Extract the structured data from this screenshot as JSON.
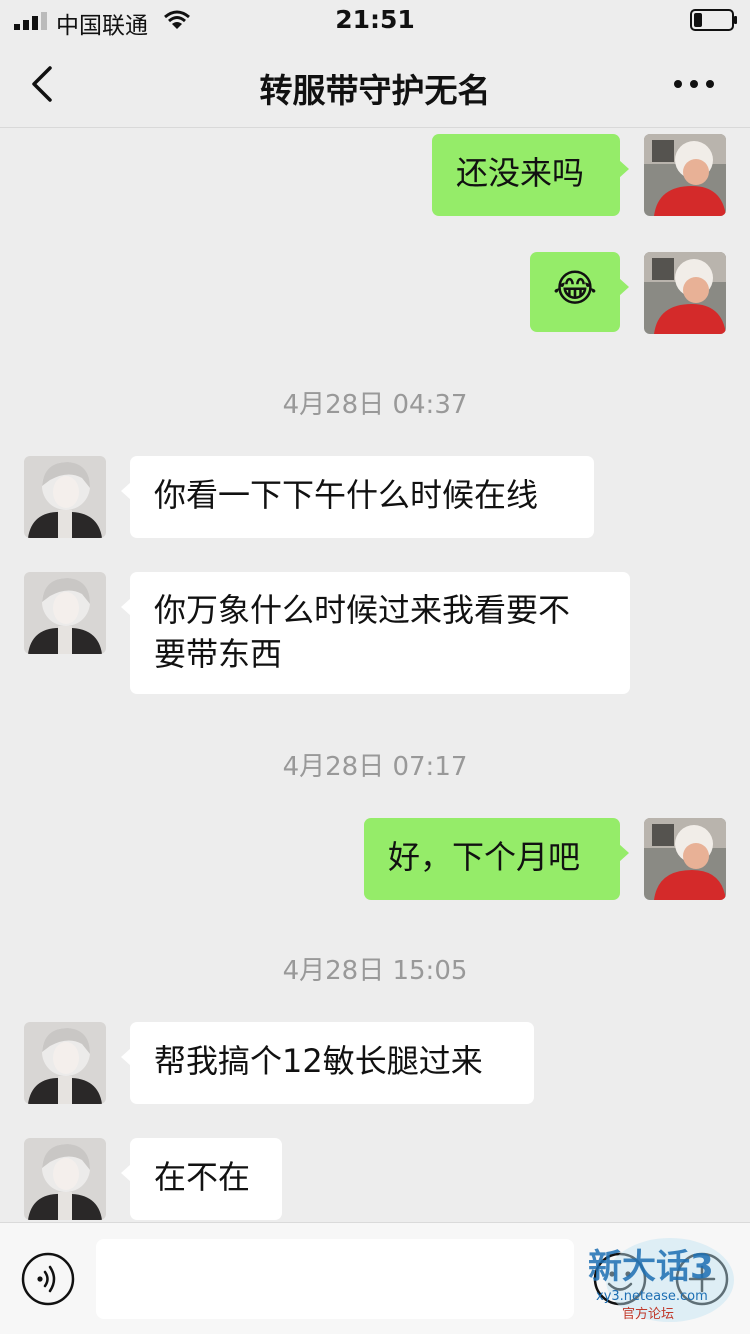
{
  "status_bar": {
    "carrier": "中国联通",
    "time": "21:51"
  },
  "nav": {
    "title": "转服带守护无名"
  },
  "messages": {
    "m1": {
      "text": "还没来吗"
    },
    "m2": {
      "emoji": "😂"
    },
    "ts1": {
      "text": "4月28日 04:37"
    },
    "m3": {
      "text": "你看一下下午什么时候在线"
    },
    "m4": {
      "line1": "你万象什么时候过来我看要不",
      "line2": "要带东西"
    },
    "ts2": {
      "text": "4月28日 07:17"
    },
    "m5": {
      "text": "好，下个月吧"
    },
    "ts3": {
      "text": "4月28日 15:05"
    },
    "m6": {
      "text": "帮我搞个12敏长腿过来"
    },
    "m7": {
      "text": "在不在"
    }
  },
  "input_bar": {
    "value": "",
    "placeholder": ""
  },
  "watermark": {
    "logo": "新大话3",
    "url": "xy3.netease.com",
    "caption": "官方论坛"
  },
  "colors": {
    "my_bubble": "#95ec69",
    "their_bubble": "#ffffff",
    "background": "#ededed"
  }
}
